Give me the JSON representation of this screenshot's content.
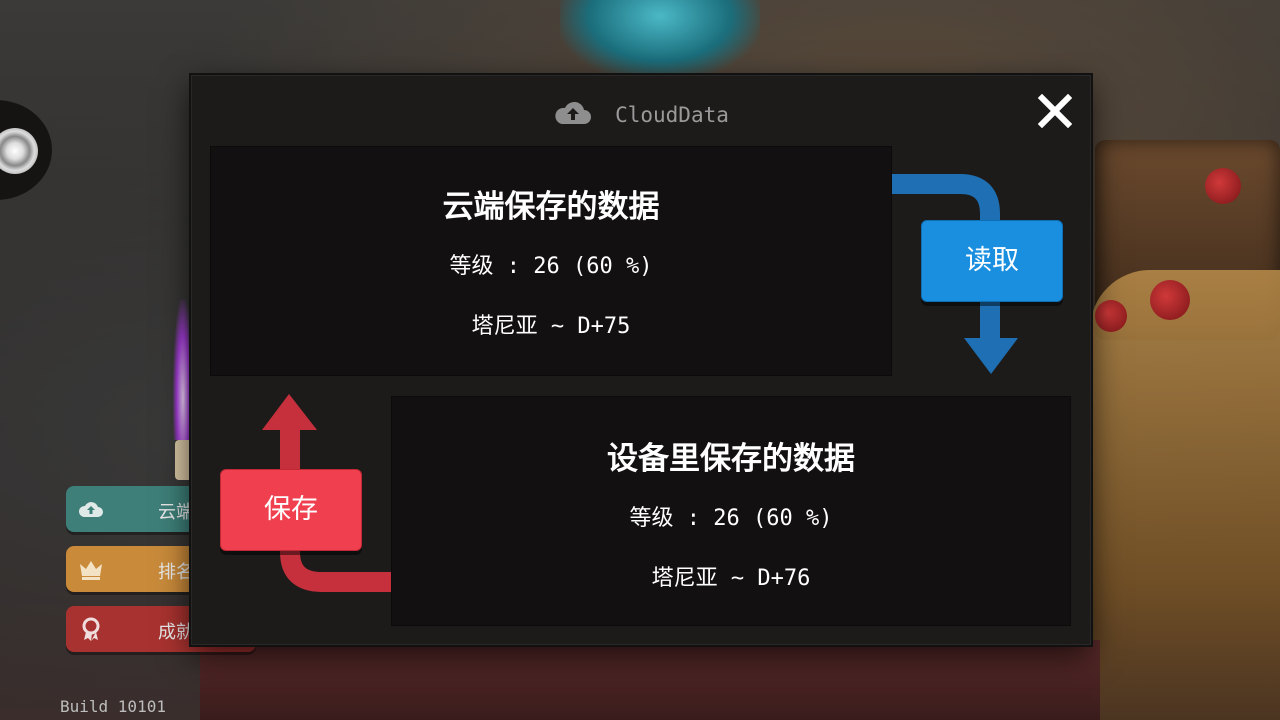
{
  "modal": {
    "title": "CloudData",
    "title_icon": "cloud-upload-icon",
    "close_icon": "close-icon",
    "close_label": "X"
  },
  "cloud_save": {
    "heading": "云端保存的数据",
    "level_line": "等级 : 26 (60 %)",
    "stage_line": "塔尼亚 ~ D+75"
  },
  "device_save": {
    "heading": "设备里保存的数据",
    "level_line": "等级 : 26 (60 %)",
    "stage_line": "塔尼亚 ~ D+76"
  },
  "buttons": {
    "load_label": "读取",
    "save_label": "保存"
  },
  "side_menu": {
    "items": [
      {
        "label": "云端",
        "icon": "cloud-upload-icon",
        "color": "#3e7f79"
      },
      {
        "label": "排名",
        "icon": "crown-icon",
        "color": "#c98a3a"
      },
      {
        "label": "成就",
        "icon": "ribbon-badge-icon",
        "color": "#a8322f"
      }
    ]
  },
  "build": "Build 10101",
  "colors": {
    "load_button": "#1a8fe0",
    "save_button": "#f0404f",
    "load_arrow": "#1e6fb3",
    "save_arrow": "#c5303c"
  }
}
